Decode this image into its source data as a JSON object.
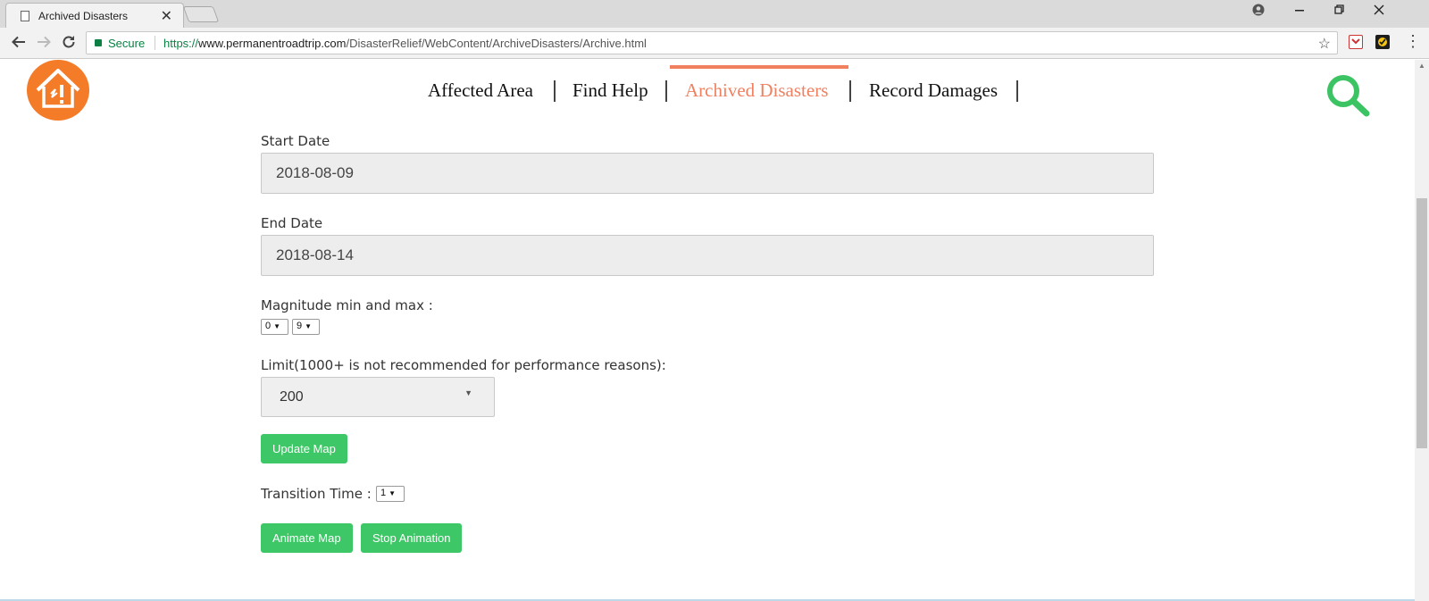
{
  "browser": {
    "tab_title": "Archived Disasters",
    "tab_close": "✕",
    "secure_label": "Secure",
    "url_proto": "https://",
    "url_host": "www.permanentroadtrip.com",
    "url_path": "/DisasterRelief/WebContent/ArchiveDisasters/Archive.html"
  },
  "nav": {
    "items": [
      {
        "label": "Affected Area"
      },
      {
        "label": "Find Help"
      },
      {
        "label": "Archived Disasters"
      },
      {
        "label": "Record Damages"
      }
    ],
    "active_index": 2,
    "accent_color": "#f08060"
  },
  "form": {
    "start_date_label": "Start Date",
    "start_date_value": "2018-08-09",
    "end_date_label": "End Date",
    "end_date_value": "2018-08-14",
    "magnitude_label": "Magnitude min and max :",
    "magnitude_min": "0",
    "magnitude_max": "9",
    "limit_label": "Limit(1000+ is not recommended for performance reasons):",
    "limit_value": "200",
    "update_button": "Update Map",
    "transition_label": "Transition Time :",
    "transition_value": "1",
    "animate_button": "Animate Map",
    "stop_button": "Stop Animation"
  },
  "colors": {
    "button_green": "#3ec766",
    "logo_orange": "#f47b28",
    "search_green": "#3cc464"
  }
}
